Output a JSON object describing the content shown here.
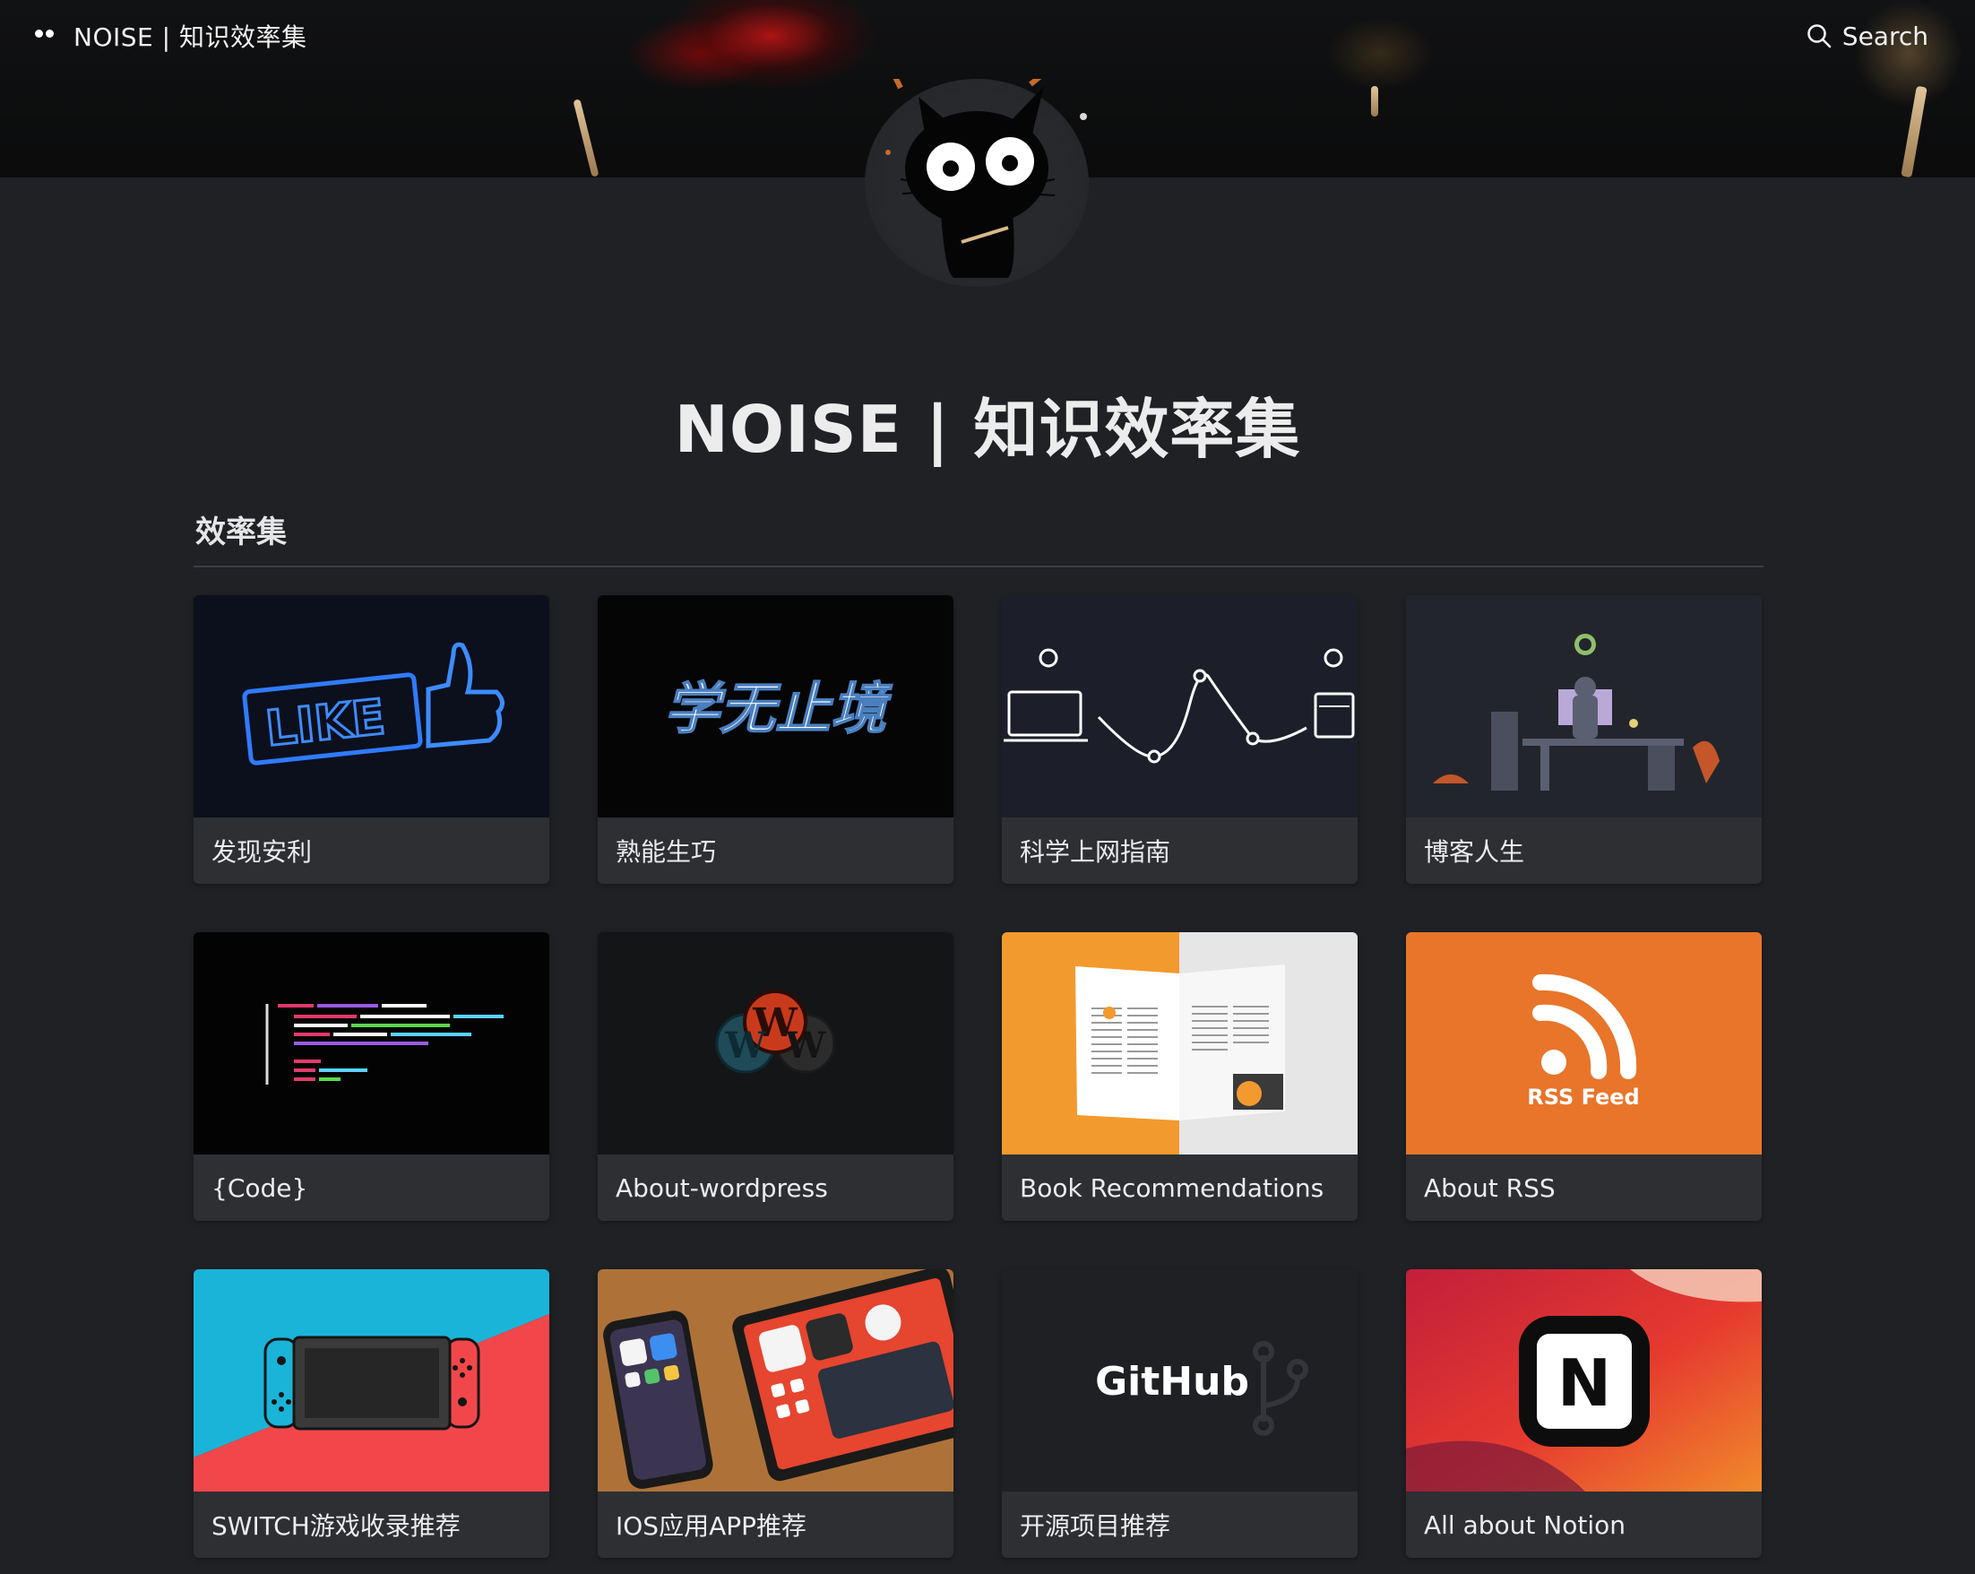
{
  "header": {
    "site_title": "NOISE | 知识效率集",
    "search_label": "Search"
  },
  "page": {
    "title": "NOISE | 知识效率集",
    "section_title": "效率集"
  },
  "cards": [
    {
      "label": "发现安利",
      "thumb_text": "LIKE",
      "icon": "neon-like-thumbs-up"
    },
    {
      "label": "熟能生巧",
      "thumb_text": "学无止境",
      "icon": "calligraphy"
    },
    {
      "label": "科学上网指南",
      "icon": "network-wave"
    },
    {
      "label": "博客人生",
      "icon": "desk-workspace"
    },
    {
      "label": "{Code}",
      "icon": "code-lines"
    },
    {
      "label": "About-wordpress",
      "icon": "wordpress-logo"
    },
    {
      "label": "Book Recommendations",
      "icon": "open-book"
    },
    {
      "label": "About RSS",
      "thumb_text": "RSS Feed",
      "icon": "rss-icon"
    },
    {
      "label": "SWITCH游戏收录推荐",
      "icon": "nintendo-switch"
    },
    {
      "label": "IOS应用APP推荐",
      "icon": "ios-devices"
    },
    {
      "label": "开源项目推荐",
      "thumb_text": "GitHub",
      "icon": "github-branch"
    },
    {
      "label": "All about Notion",
      "thumb_text": "N",
      "icon": "notion-logo"
    }
  ],
  "colors": {
    "background": "#1f2125",
    "card": "#2d2f33",
    "rss_orange": "#e8752a",
    "switch_blue": "#1ab4d8",
    "switch_red": "#f2474a"
  }
}
